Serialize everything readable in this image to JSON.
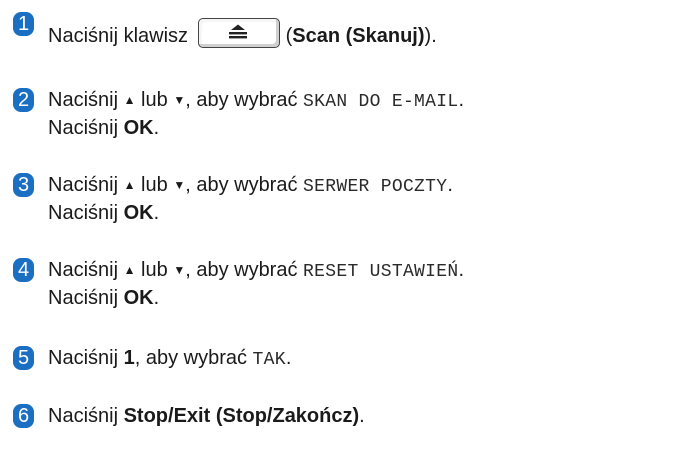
{
  "steps": [
    {
      "number": "1",
      "line1": {
        "prefix": "Naciśnij klawisz",
        "key_icon": "scan-key-icon",
        "paren_open": "(",
        "bold": "Scan (Skanuj)",
        "suffix": ")."
      }
    },
    {
      "number": "2",
      "line1": {
        "prefix": "Naciśnij",
        "up": "▲",
        "or": "lub",
        "down": "▼",
        "mid": ", aby wybrać",
        "mono": "SKAN DO E-MAIL",
        "end": "."
      },
      "line2": {
        "prefix": "Naciśnij",
        "bold": "OK",
        "end": "."
      }
    },
    {
      "number": "3",
      "line1": {
        "prefix": "Naciśnij",
        "up": "▲",
        "or": "lub",
        "down": "▼",
        "mid": ", aby wybrać",
        "mono": "SERWER POCZTY",
        "end": "."
      },
      "line2": {
        "prefix": "Naciśnij",
        "bold": "OK",
        "end": "."
      }
    },
    {
      "number": "4",
      "line1": {
        "prefix": "Naciśnij",
        "up": "▲",
        "or": "lub",
        "down": "▼",
        "mid": ", aby wybrać",
        "mono": "RESET USTAWIEŃ",
        "end": "."
      },
      "line2": {
        "prefix": "Naciśnij",
        "bold": "OK",
        "end": "."
      }
    },
    {
      "number": "5",
      "line1": {
        "prefix": "Naciśnij",
        "bold": "1",
        "mid": ", aby wybrać",
        "mono": "TAK",
        "end": "."
      }
    },
    {
      "number": "6",
      "line1": {
        "prefix": "Naciśnij",
        "bold": "Stop/Exit (Stop/Zakończ)",
        "end": "."
      }
    }
  ],
  "colors": {
    "badge": "#1b6fc2",
    "text": "#1a1a1a"
  }
}
